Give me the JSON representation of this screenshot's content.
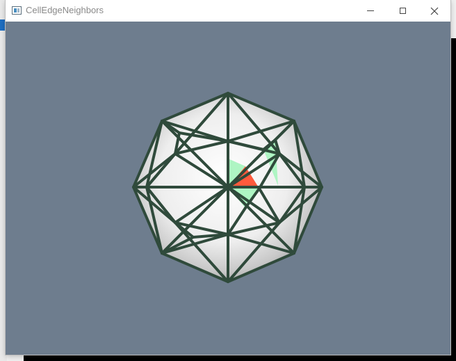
{
  "window": {
    "title": "CellEdgeNeighbors"
  },
  "titlebar_buttons": {
    "minimize_icon": "minimize-icon",
    "maximize_icon": "maximize-icon",
    "close_icon": "close-icon"
  },
  "viewport": {
    "background_color": "#6e7d8e",
    "edge_color": "#2f4a3b",
    "selected_cell_color": "#ff5a3c",
    "neighbor_cell_color": "#aef5c3"
  }
}
